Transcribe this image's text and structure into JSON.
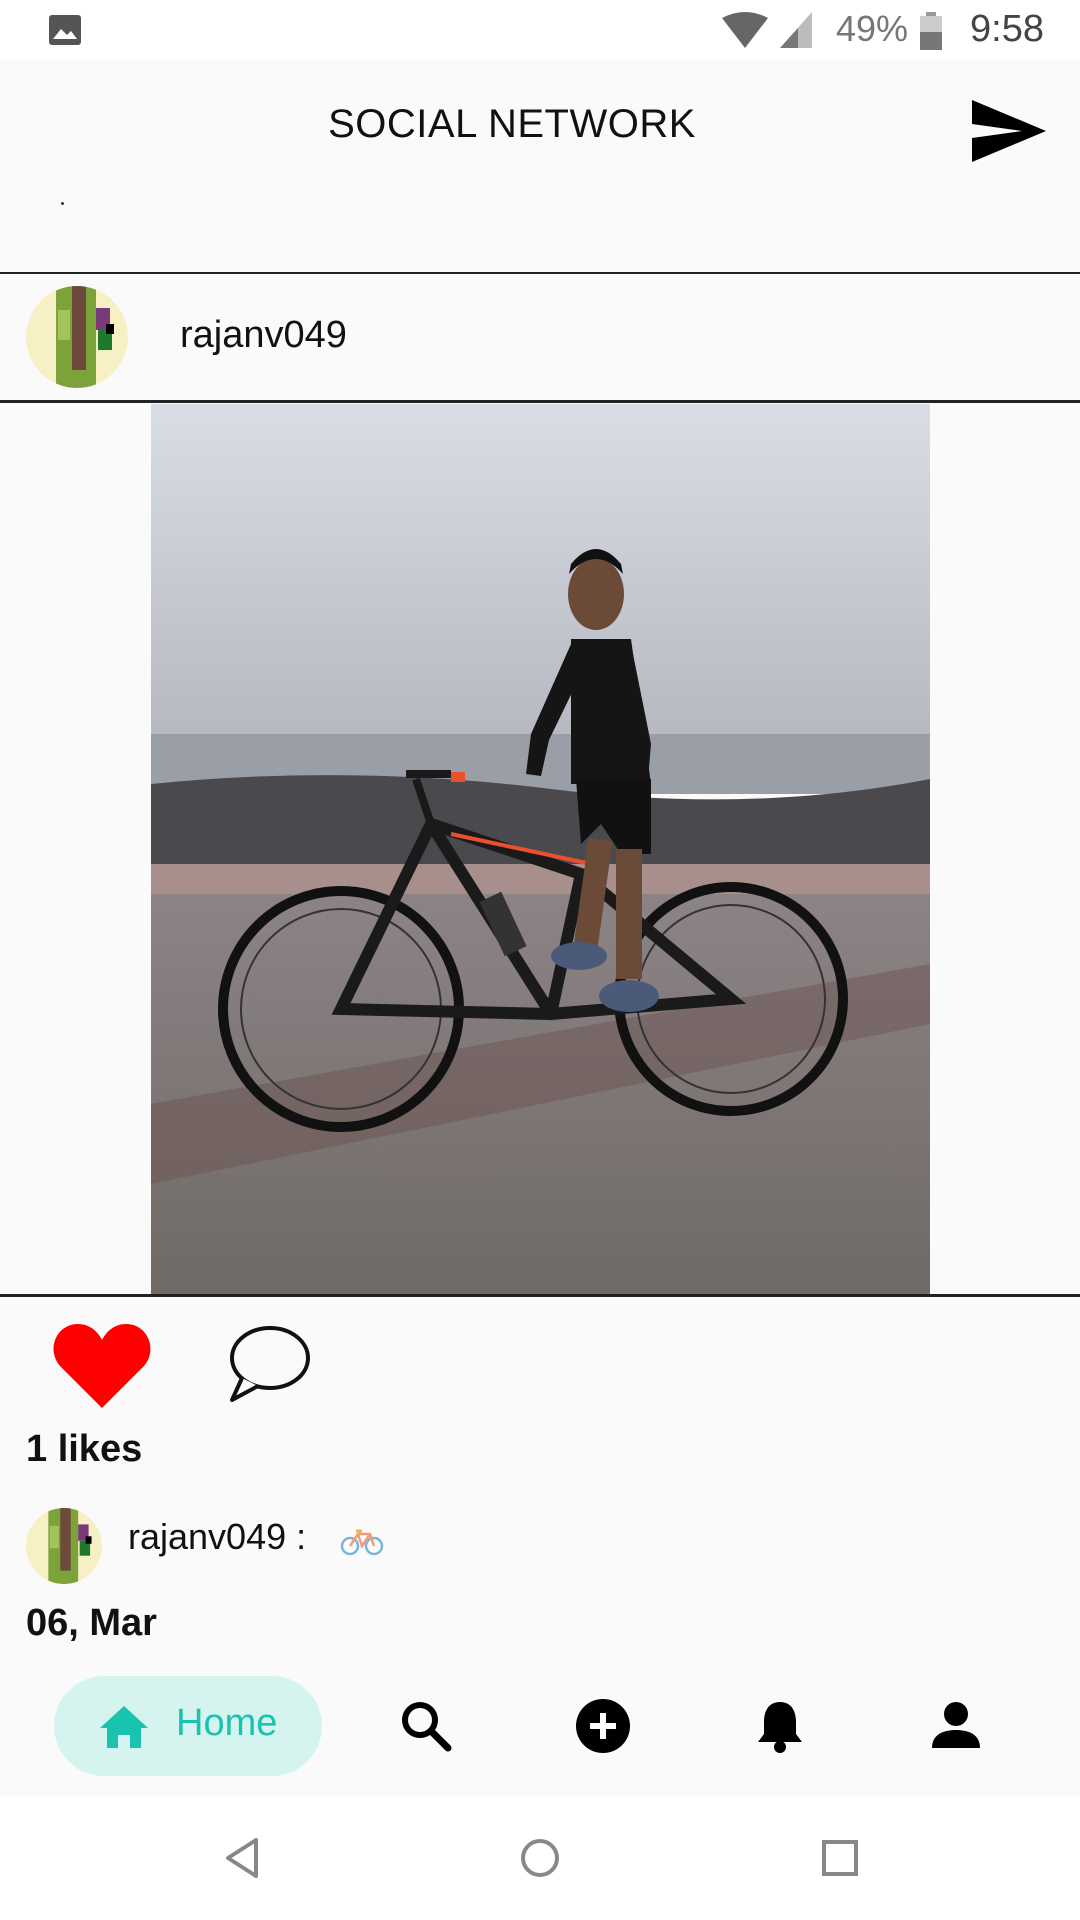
{
  "status_bar": {
    "battery_percent": "49%",
    "time": "9:58",
    "icons": [
      "image-icon",
      "wifi-icon",
      "signal-icon",
      "battery-icon"
    ]
  },
  "app_bar": {
    "title": "SOCIAL NETWORK",
    "action_icon": "send-icon"
  },
  "post": {
    "username": "rajanv049",
    "image_subject": "photo",
    "liked": true,
    "likes_text": "1 likes",
    "caption_user": "rajanv049 :",
    "caption_emoji_icon": "bicycle-icon",
    "date": "06, Mar"
  },
  "bottom_nav": {
    "home_label": "Home",
    "items": [
      "home-icon",
      "search-icon",
      "add-icon",
      "notifications-icon",
      "profile-icon"
    ],
    "accent_color": "#19c3b0",
    "active_bg": "#d6f4ef"
  },
  "colors": {
    "like": "#ff0000",
    "text": "#111111"
  }
}
